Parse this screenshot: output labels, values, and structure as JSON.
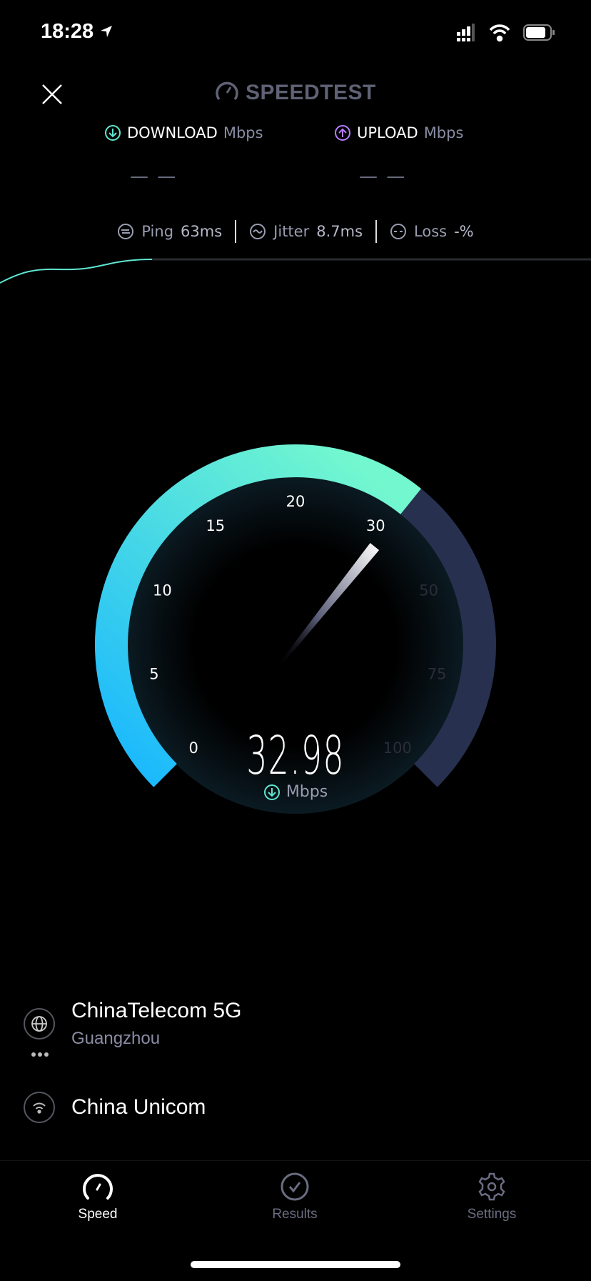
{
  "status_bar": {
    "time": "18:28",
    "icons": [
      "location-arrow-icon",
      "signal-icon",
      "wifi-icon",
      "battery-icon"
    ]
  },
  "header": {
    "brand": "SPEEDTEST",
    "close_icon": "close-icon"
  },
  "results": {
    "download": {
      "label": "DOWNLOAD",
      "unit": "Mbps",
      "value": "— —",
      "color": "#5ee6d0"
    },
    "upload": {
      "label": "UPLOAD",
      "unit": "Mbps",
      "value": "— —",
      "color": "#b87cff"
    }
  },
  "metrics": {
    "ping": {
      "label": "Ping",
      "value": "63ms"
    },
    "jitter": {
      "label": "Jitter",
      "value": "8.7ms"
    },
    "loss": {
      "label": "Loss",
      "value": "-%"
    }
  },
  "gauge": {
    "value": 32.98,
    "value_text": "32.98",
    "unit": "Mbps",
    "ticks": [
      "0",
      "5",
      "10",
      "15",
      "20",
      "30",
      "50",
      "75",
      "100"
    ],
    "colors": {
      "fill_start": "#17b6ff",
      "fill_end": "#72f7cf",
      "track": "#27314f",
      "tick_active": "#ffffff",
      "tick_inactive": "#2b2d38"
    }
  },
  "server": {
    "isp": "ChinaTelecom 5G",
    "location": "Guangzhou"
  },
  "connection": {
    "provider": "China Unicom"
  },
  "tabs": [
    {
      "label": "Speed",
      "active": true
    },
    {
      "label": "Results",
      "active": false
    },
    {
      "label": "Settings",
      "active": false
    }
  ]
}
